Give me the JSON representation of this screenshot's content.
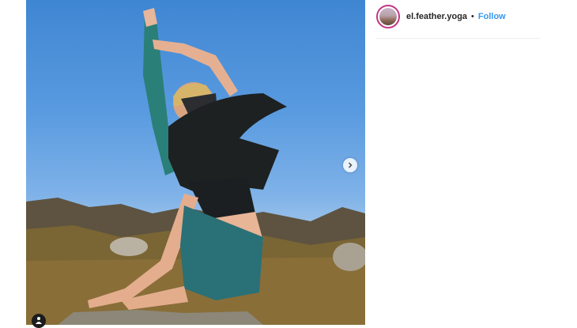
{
  "post": {
    "image_alt": "Yoga pose photograph",
    "next_icon": "chevron-right-icon",
    "tag_icon": "user-tag-icon"
  },
  "header": {
    "username": "el.feather.yoga",
    "separator": "•",
    "follow_label": "Follow",
    "avatar_icon": "avatar"
  },
  "colors": {
    "follow_blue": "#3897f0",
    "username_text": "#262626",
    "avatar_ring": "#c13584"
  }
}
